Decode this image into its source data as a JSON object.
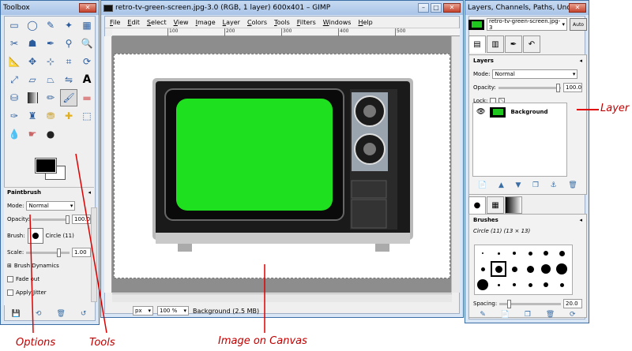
{
  "toolbox": {
    "title": "Toolbox",
    "options_title": "Paintbrush",
    "mode_label": "Mode:",
    "mode_value": "Normal",
    "opacity_label": "Opacity:",
    "opacity_value": "100.0",
    "opacity_level": 1.0,
    "brush_label": "Brush:",
    "brush_name": "Circle (11)",
    "scale_label": "Scale:",
    "scale_value": "1.00",
    "dynamics_label": "Brush Dynamics",
    "fade_label": "Fade out",
    "jitter_label": "Apply Jitter",
    "tools": [
      "rect-select",
      "ellipse-select",
      "free-select",
      "fuzzy-select",
      "color-select",
      "scissors",
      "foreground-select",
      "paths",
      "color-picker",
      "zoom",
      "measure",
      "move",
      "align",
      "crop",
      "rotate",
      "scale",
      "shear",
      "perspective",
      "flip",
      "text",
      "bucket-fill",
      "blend",
      "pencil",
      "paintbrush",
      "eraser",
      "airbrush",
      "ink",
      "clone",
      "heal",
      "perspective-clone",
      "smudge",
      "blur",
      "dodge-burn"
    ],
    "selected_tool": "paintbrush",
    "fg_color": "#000000",
    "bg_color": "#ffffff"
  },
  "image_window": {
    "title": "retro-tv-green-screen.jpg-3.0 (RGB, 1 layer) 600x401 – GIMP",
    "menu": [
      "File",
      "Edit",
      "Select",
      "View",
      "Image",
      "Layer",
      "Colors",
      "Tools",
      "Filters",
      "Windows",
      "Help"
    ],
    "ruler_ticks": [
      "100",
      "200",
      "300",
      "400",
      "500"
    ],
    "unit": "px",
    "zoom": "100 %",
    "status": "Background (2.5 MB)",
    "screen_color": "#1ee01e"
  },
  "dock": {
    "title": "Layers, Channels, Paths, Undo – Br...",
    "image_name": "retro-tv-green-screen.jpg-3",
    "auto_label": "Auto",
    "layers_title": "Layers",
    "mode_label": "Mode:",
    "mode_value": "Normal",
    "opacity_label": "Opacity:",
    "opacity_value": "100.0",
    "opacity_level": 1.0,
    "lock_label": "Lock:",
    "layer_name": "Background",
    "brushes_title": "Brushes",
    "brush_info": "Circle (11) (13 × 13)",
    "spacing_label": "Spacing:",
    "spacing_value": "20.0"
  },
  "annotations": {
    "layer": "Layer",
    "options": "Options",
    "tools": "Tools",
    "canvas": "Image on Canvas"
  }
}
